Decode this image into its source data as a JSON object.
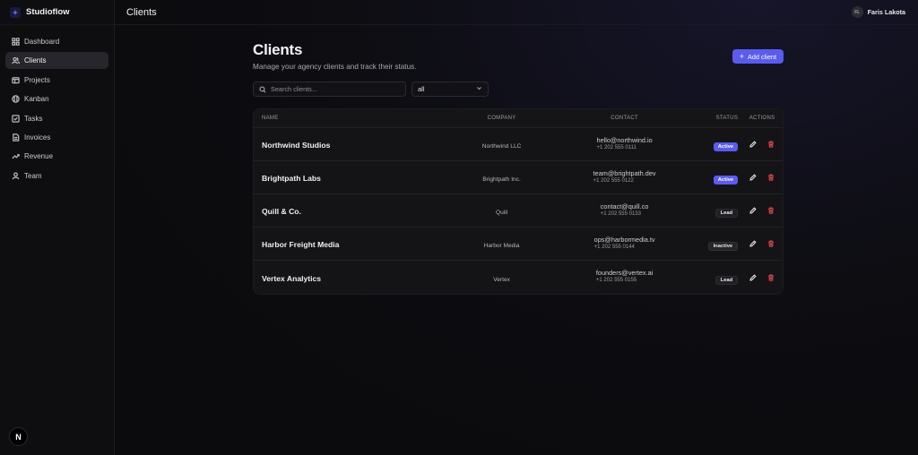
{
  "app": {
    "name": "Studioflow"
  },
  "sidebar": {
    "items": [
      {
        "label": "Dashboard",
        "icon": "grid-icon"
      },
      {
        "label": "Clients",
        "icon": "users-icon"
      },
      {
        "label": "Projects",
        "icon": "folder-icon"
      },
      {
        "label": "Kanban",
        "icon": "columns-icon"
      },
      {
        "label": "Tasks",
        "icon": "checkbox-icon"
      },
      {
        "label": "Invoices",
        "icon": "file-icon"
      },
      {
        "label": "Revenue",
        "icon": "trend-icon"
      },
      {
        "label": "Team",
        "icon": "user-icon"
      }
    ],
    "footer_badge": "N"
  },
  "topbar": {
    "title": "Clients",
    "user_initials": "FL",
    "user_name": "Faris Lakota"
  },
  "page": {
    "title": "Clients",
    "subtitle": "Manage your agency clients and track their status.",
    "add_label": "Add client"
  },
  "filters": {
    "search_placeholder": "Search clients...",
    "status_value": "all"
  },
  "table": {
    "headers": {
      "name": "NAME",
      "company": "COMPANY",
      "contact": "CONTACT",
      "status": "STATUS",
      "actions": "ACTIONS"
    },
    "rows": [
      {
        "name": "Northwind Studios",
        "company": "Northwind LLC",
        "email": "hello@northwind.io",
        "phone": "+1 202 555 0111",
        "status": "Active"
      },
      {
        "name": "Brightpath Labs",
        "company": "Brightpath Inc.",
        "email": "team@brightpath.dev",
        "phone": "+1 202 555 0122",
        "status": "Active"
      },
      {
        "name": "Quill & Co.",
        "company": "Quill",
        "email": "contact@quill.co",
        "phone": "+1 202 555 0133",
        "status": "Lead"
      },
      {
        "name": "Harbor Freight Media",
        "company": "Harbor Media",
        "email": "ops@harbormedia.tv",
        "phone": "+1 202 555 0144",
        "status": "Inactive"
      },
      {
        "name": "Vertex Analytics",
        "company": "Vertex",
        "email": "founders@vertex.ai",
        "phone": "+1 202 555 0155",
        "status": "Lead"
      }
    ]
  },
  "colors": {
    "accent": "#5b5bf0",
    "danger": "#e0484a",
    "background": "#0b0b0d"
  }
}
